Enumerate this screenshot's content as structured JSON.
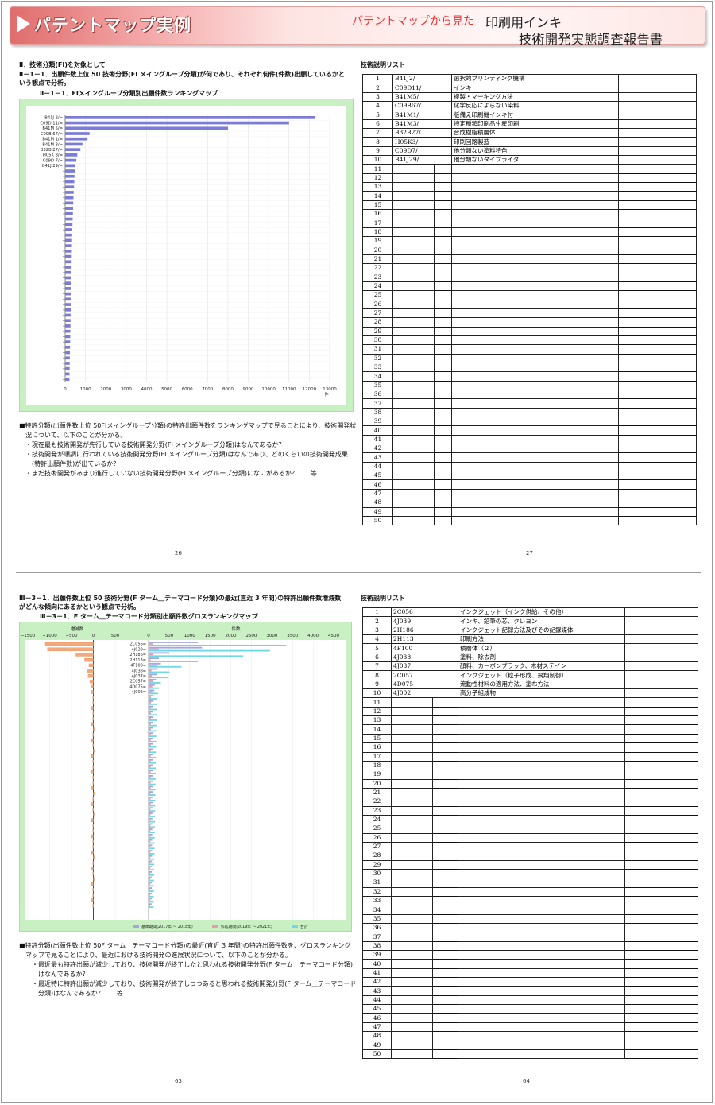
{
  "banner": {
    "title": "パテントマップ実例",
    "subtitle": "パテントマップから見た",
    "right_line1": "印刷用インキ",
    "right_line2": "技術開発実態調査報告書"
  },
  "top_left": {
    "heading": "Ⅱ．技術分類(FI)を対象として",
    "para_line1": "Ⅱ－1－1．出願件数上位 50 技術分野(FI メイングループ分類)が何であり、それぞれ何件(件数)出願しているかと",
    "para_line2": "いう観点で分析。",
    "chart_title": "Ⅱ－1－1．FIメイングループ分類別出願件数ランキングマップ",
    "notes": [
      "■特許分類(出願件数上位 50FIメイングループ分類)の特許出願件数をランキングマップで見ることにより、技術開発状",
      "　況について、以下のことが分かる。",
      "　・現在最も技術開発が先行している技術開発分野(FI メイングループ分類)はなんであるか？",
      "　・技術開発が順調に行われている技術開発分野(FI メイングループ分類)はなんであり、どのくらいの技術開発成果",
      "　　(特許出願件数)が出ているか？",
      "　・まだ技術開発があまり進行していない技術開発分野(FI メイングループ分類)になにがあるか？　　等"
    ],
    "page_number": "26"
  },
  "top_right": {
    "list_title": "技術説明リスト",
    "rows": [
      {
        "n": "1",
        "code": "B41J2/",
        "desc": "選択的プリンティング機構"
      },
      {
        "n": "2",
        "code": "C09D11/",
        "desc": "インキ"
      },
      {
        "n": "3",
        "code": "B41M5/",
        "desc": "複製・マーキング方法"
      },
      {
        "n": "4",
        "code": "C09B67/",
        "desc": "化学反応によらない染料"
      },
      {
        "n": "5",
        "code": "B41M1/",
        "desc": "版備え印刷機インキ付"
      },
      {
        "n": "6",
        "code": "B41M3/",
        "desc": "特定種類印刷品生産印刷"
      },
      {
        "n": "7",
        "code": "B32B27/",
        "desc": "合成樹脂積層体"
      },
      {
        "n": "8",
        "code": "H05K3/",
        "desc": "印刷回路製造"
      },
      {
        "n": "9",
        "code": "C09D7/",
        "desc": "他分類ない塗料特色"
      },
      {
        "n": "10",
        "code": "B41J29/",
        "desc": "他分類ないタイプライタ"
      }
    ],
    "page_number": "27"
  },
  "bottom_left": {
    "para_line1": "Ⅲ－3－1．出願件数上位 50 技術分野(F ターム＿テーマコード分類)の最近(直近 3 年間)の特許出願件数増減数",
    "para_line2": "がどんな傾向にあるかという観点で分析。",
    "chart_title": "Ⅲ－3－1．F ターム＿テーマコード分類別出願件数グロスランキングマップ",
    "notes": [
      "■特許分類(出願件数上位 50F ターム＿テーマコード分類)の最近(直近 3 年間)の特許出願件数を、グロスランキング",
      "　マップで見ることにより、最近における技術開発の進展状況について、以下のことが分かる。",
      "　　・最近最も特許出願が減少しており、技術開発が終了したと思われる技術開発分野(F ターム＿テーマコード分類)",
      "　　　はなんであるか？",
      "　　・最近特に特許出願が減少しており、技術開発が終了しつつあると思われる技術開発分野(F ターム＿テーマコード",
      "　　　分類)はなんであるか？　　等"
    ],
    "page_number": "63"
  },
  "bottom_right": {
    "list_title": "技術説明リスト",
    "rows": [
      {
        "n": "1",
        "code": "2C056",
        "desc": "インクジェット（インク供給、その他）"
      },
      {
        "n": "2",
        "code": "4J039",
        "desc": "インキ、鉛筆の芯、クレヨン"
      },
      {
        "n": "3",
        "code": "2H186",
        "desc": "インクジェット記録方法及びその記録媒体"
      },
      {
        "n": "4",
        "code": "2H113",
        "desc": "印刷方法"
      },
      {
        "n": "5",
        "code": "4F100",
        "desc": "積層体（２）"
      },
      {
        "n": "6",
        "code": "4J038",
        "desc": "塗料、除去剤"
      },
      {
        "n": "7",
        "code": "4J037",
        "desc": "顔料、カーボンブラック、木材ステイン"
      },
      {
        "n": "8",
        "code": "2C057",
        "desc": "インクジェット（粒子形成、飛翔制御）"
      },
      {
        "n": "9",
        "code": "4D075",
        "desc": "流動性材料の適用方法、塗布方法"
      },
      {
        "n": "10",
        "code": "4J002",
        "desc": "高分子組成物"
      }
    ],
    "page_number": "64"
  },
  "chart_data": [
    {
      "type": "bar",
      "orientation": "horizontal",
      "categories": [
        "B41J 2/",
        "C09D 11/",
        "B41M 5/",
        "C09B 67/",
        "B41M 1/",
        "B41M 3/",
        "B32B 27/",
        "H05K 3/",
        "C09D 7/",
        "B41J 29/"
      ],
      "values": [
        12300,
        11000,
        8000,
        1200,
        1100,
        850,
        750,
        600,
        550,
        500
      ],
      "tail_values": [
        480,
        460,
        450,
        440,
        420,
        410,
        400,
        390,
        380,
        370,
        360,
        350,
        345,
        340,
        335,
        330,
        325,
        320,
        315,
        310,
        305,
        300,
        295,
        290,
        285,
        280,
        275,
        270,
        265,
        260,
        255,
        250,
        245,
        240,
        235,
        230,
        225,
        220,
        215,
        210
      ],
      "xlim": [
        0,
        13000
      ],
      "xticks": [
        "0",
        "1000",
        "2000",
        "3000",
        "4000",
        "5000",
        "6000",
        "7000",
        "8000",
        "9000",
        "10000",
        "11000",
        "12000",
        "13000"
      ],
      "xunit": "件",
      "color": "#7b7bd8",
      "grid": true
    },
    {
      "type": "bar",
      "orientation": "horizontal",
      "diverging": {
        "label": "増減数",
        "xticks": [
          "−1500",
          "−1000",
          "−500",
          "0",
          "500"
        ],
        "xlim": [
          -1500,
          500
        ],
        "values": [
          -1100,
          -1050,
          -400,
          -200,
          -100,
          -150,
          -120,
          -80,
          -60,
          -50
        ]
      },
      "stacked": {
        "label": "件数",
        "xticks": [
          "0",
          "500",
          "1000",
          "1500",
          "2000",
          "2500",
          "3000",
          "3500",
          "4000",
          "4500"
        ],
        "xlim": [
          0,
          4500
        ],
        "categories": [
          "2C056",
          "4J039",
          "2H186",
          "2H113",
          "4F100",
          "4J038",
          "4J037",
          "2C057",
          "4D075",
          "4J002"
        ],
        "series": [
          {
            "name": "基準期間(2017年 ～ 2018年)",
            "color": "#a3a3e8",
            "values": [
              1200,
              1300,
              500,
              250,
              300,
              220,
              200,
              180,
              150,
              140
            ]
          },
          {
            "name": "作成期間(2019年 ～ 2021年)",
            "color": "#e89ab5",
            "values": [
              100,
              250,
              100,
              50,
              200,
              70,
              80,
              100,
              90,
              90
            ]
          },
          {
            "name": "合計",
            "color": "#6fd8e0",
            "values": [
              3350,
              2950,
              2300,
              1200,
              800,
              510,
              470,
              300,
              250,
              230
            ]
          }
        ]
      }
    }
  ]
}
